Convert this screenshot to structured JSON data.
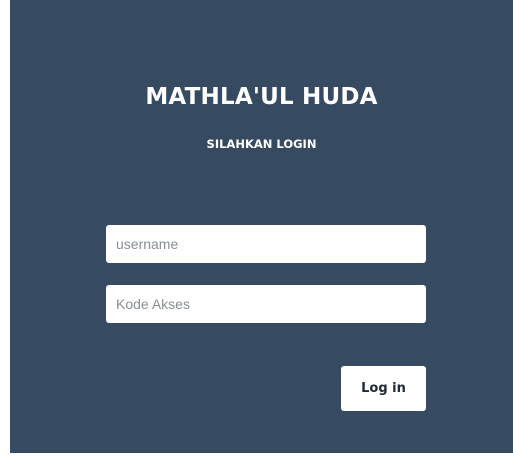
{
  "login": {
    "title": "MATHLA'UL HUDA",
    "subtitle": "SILAHKAN LOGIN",
    "username_placeholder": "username",
    "username_value": "",
    "code_placeholder": "Kode Akses",
    "code_value": "",
    "button_label": "Log in"
  },
  "colors": {
    "panel_background": "#364a61",
    "input_background": "#ffffff",
    "text_light": "#ffffff"
  }
}
